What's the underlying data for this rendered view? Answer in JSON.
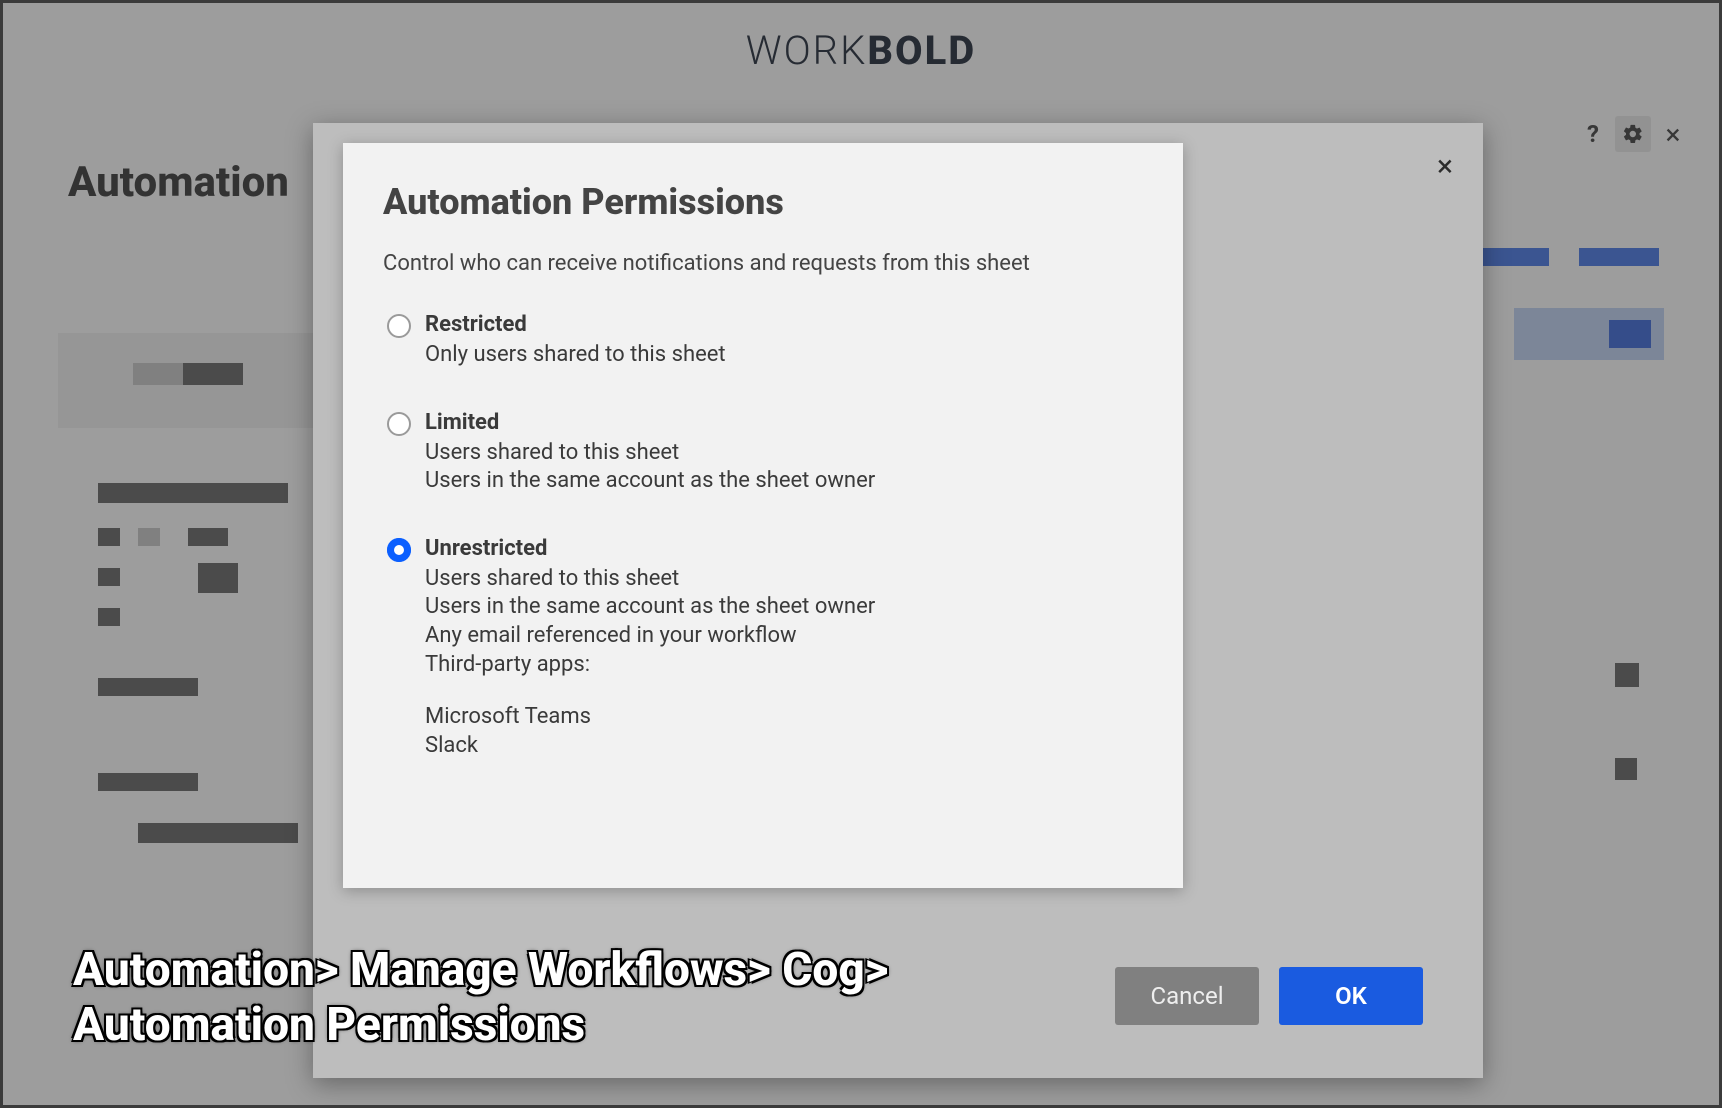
{
  "brand": {
    "light": "WORK",
    "bold": "BOLD"
  },
  "page": {
    "title": "Automation"
  },
  "header_icons": {
    "help": "?",
    "settings": "gear",
    "close": "×"
  },
  "outer_modal": {
    "close": "×"
  },
  "dialog": {
    "title": "Automation Permissions",
    "subtitle": "Control who can receive notifications and requests from this sheet",
    "selected": "unrestricted",
    "options": {
      "restricted": {
        "title": "Restricted",
        "lines": [
          "Only users shared to this sheet"
        ]
      },
      "limited": {
        "title": "Limited",
        "lines": [
          "Users shared to this sheet",
          "Users in the same account as the sheet owner"
        ]
      },
      "unrestricted": {
        "title": "Unrestricted",
        "lines": [
          "Users shared to this sheet",
          "Users in the same account as the sheet owner",
          "Any email referenced in your workflow",
          "Third-party apps:"
        ],
        "apps": [
          "Microsoft Teams",
          "Slack"
        ]
      }
    },
    "buttons": {
      "cancel": "Cancel",
      "ok": "OK"
    }
  },
  "caption": {
    "line1": "Automation> Manage Workflows> Cog>",
    "line2": "Automation Permissions"
  }
}
